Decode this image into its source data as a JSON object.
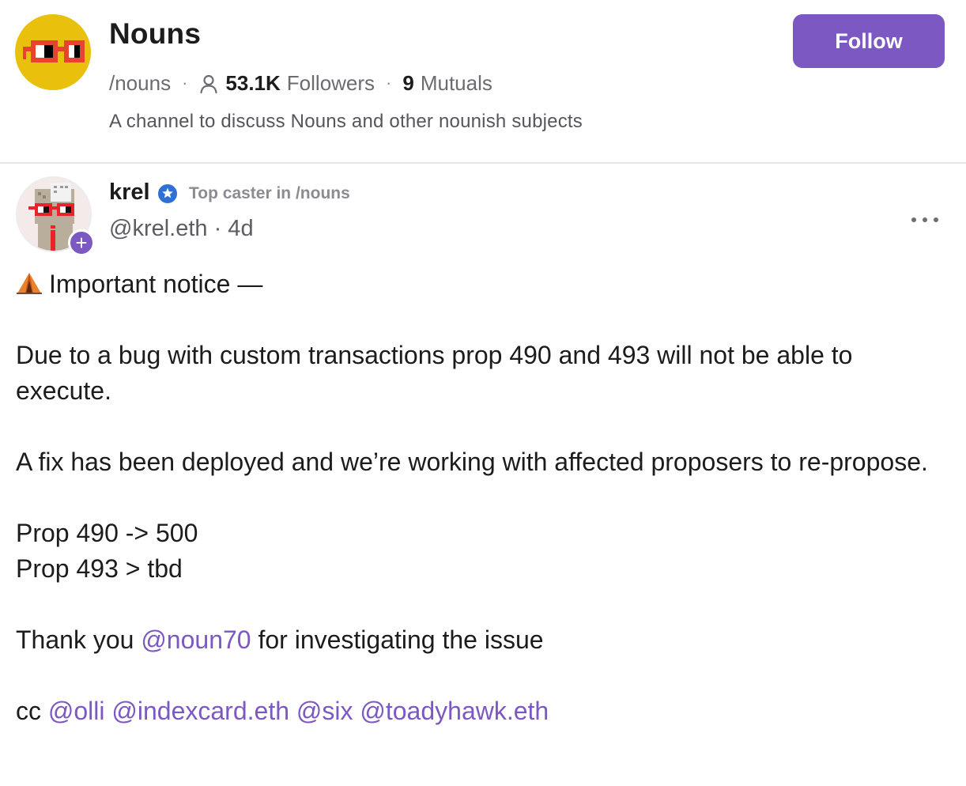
{
  "channel": {
    "name": "Nouns",
    "handle": "/nouns",
    "followers_count": "53.1K",
    "followers_label": "Followers",
    "mutuals_count": "9",
    "mutuals_label": "Mutuals",
    "description": "A channel to discuss Nouns and other nounish subjects",
    "follow_label": "Follow",
    "accent_color": "#7c58c2"
  },
  "cast": {
    "author_name": "krel",
    "badge_text": "Top caster in /nouns",
    "author_handle": "@krel.eth · 4d",
    "notice_title": "Important notice —",
    "paragraph_1": "Due to a bug with custom transactions prop 490 and 493 will not be able to execute.",
    "paragraph_2": "A fix has been deployed and we’re working with affected proposers to re-propose.",
    "prop_line_1": "Prop 490 -> 500",
    "prop_line_2": "Prop 493 > tbd",
    "thanks_prefix": "Thank you",
    "thanks_mention": "@noun70",
    "thanks_suffix": "for investigating the issue",
    "cc_prefix": "cc",
    "cc_mentions": [
      "@olli",
      "@indexcard.eth",
      "@six",
      "@toadyhawk.eth"
    ]
  },
  "icons": {
    "channel_avatar": "nouns-glasses-icon",
    "person": "person-icon",
    "verified": "verified-badge-icon",
    "notice": "tent-icon",
    "more": "more-options-icon",
    "add": "plus-icon"
  }
}
